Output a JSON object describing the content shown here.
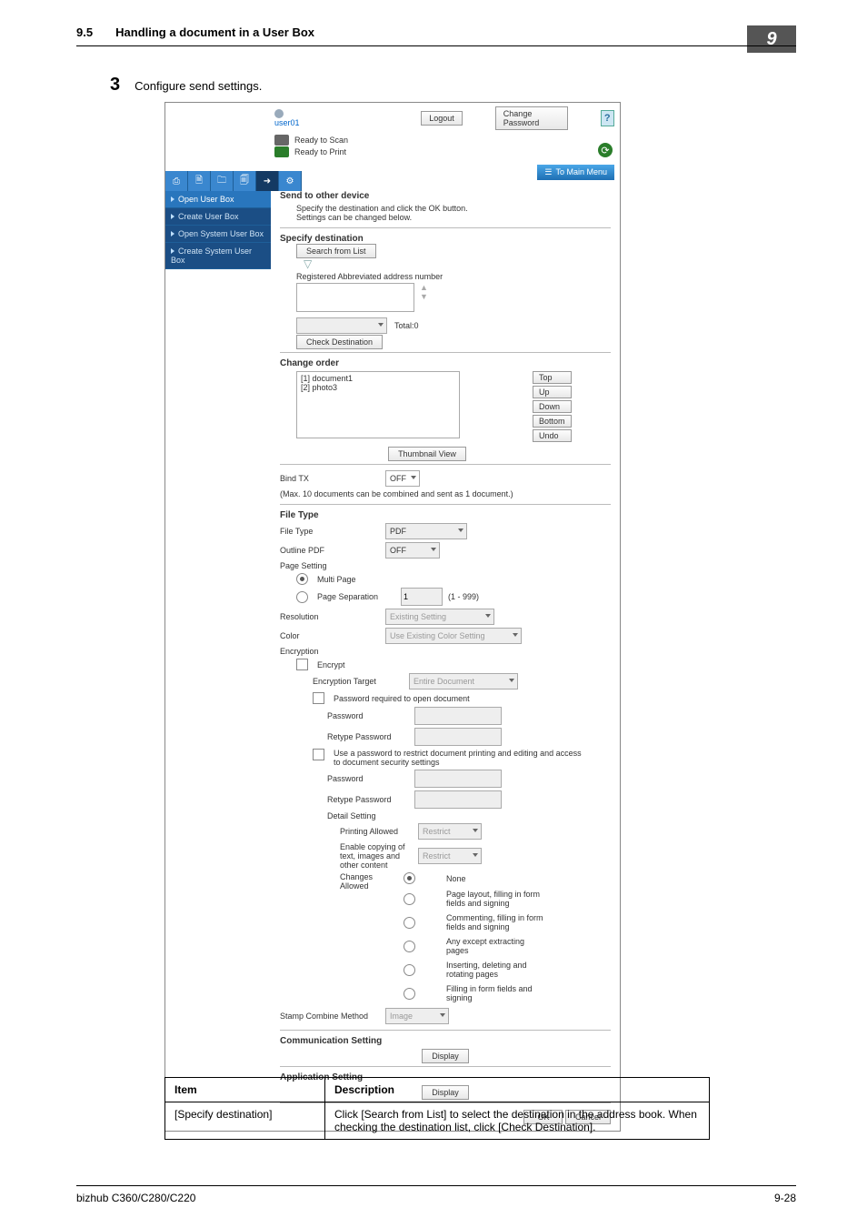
{
  "page": {
    "section_number": "9.5",
    "section_title": "Handling a document in a User Box",
    "chapter_number": "9",
    "step_number": "3",
    "step_text": "Configure send settings.",
    "model": "bizhub C360/C280/C220",
    "page_number": "9-28"
  },
  "screenshot": {
    "user": "user01",
    "buttons": {
      "logout": "Logout",
      "change_password": "Change Password"
    },
    "status": {
      "scan": "Ready to Scan",
      "print": "Ready to Print"
    },
    "main_menu": "To Main Menu",
    "sidebar": {
      "items": [
        {
          "label": "Open User Box",
          "active": true
        },
        {
          "label": "Create User Box",
          "active": false
        },
        {
          "label": "Open System User Box",
          "active": false
        },
        {
          "label": "Create System User Box",
          "active": false
        }
      ]
    },
    "send": {
      "heading": "Send to other device",
      "note1": "Specify the destination and click the OK button.",
      "note2": "Settings can be changed below."
    },
    "specify": {
      "heading": "Specify destination",
      "search_btn": "Search from List",
      "reg_label": "Registered Abbreviated address number",
      "total_label": "Total:0",
      "check_btn": "Check Destination"
    },
    "order": {
      "heading": "Change order",
      "items": [
        "[1] document1",
        "[2] photo3"
      ],
      "btns": {
        "top": "Top",
        "up": "Up",
        "down": "Down",
        "bottom": "Bottom",
        "undo": "Undo"
      },
      "thumb_btn": "Thumbnail View"
    },
    "bind": {
      "label": "Bind TX",
      "value": "OFF",
      "note": "(Max. 10 documents can be combined and sent as 1 document.)"
    },
    "filetype": {
      "heading": "File Type",
      "ft_label": "File Type",
      "ft_value": "PDF",
      "outline_label": "Outline PDF",
      "outline_value": "OFF",
      "page_setting": "Page Setting",
      "multipage": "Multi Page",
      "pagesep": "Page Separation",
      "pagesep_range": "(1 - 999)",
      "pagesep_value": "1",
      "res_label": "Resolution",
      "res_value": "Existing Setting",
      "color_label": "Color",
      "color_value": "Use Existing Color Setting",
      "enc_label": "Encryption",
      "enc_cb": "Encrypt",
      "enc_target_label": "Encryption Target",
      "enc_target_value": "Entire Document",
      "pw_open": "Password required to open document",
      "pw": "Password",
      "repw": "Retype Password",
      "use_pw_restrict": "Use a password to restrict document printing and editing and access to document security settings",
      "detail": "Detail Setting",
      "printing": "Printing Allowed",
      "printing_value": "Restrict",
      "copying": "Enable copying of text, images and other content",
      "copying_value": "Restrict",
      "changes": "Changes Allowed",
      "changes_opts": [
        "None",
        "Page layout, filling in form fields and signing",
        "Commenting, filling in form fields and signing",
        "Any except extracting pages",
        "Inserting, deleting and rotating pages",
        "Filling in form fields and signing"
      ],
      "stamp_label": "Stamp Combine Method",
      "stamp_value": "Image"
    },
    "comm": {
      "heading": "Communication Setting",
      "btn": "Display"
    },
    "app": {
      "heading": "Application Setting",
      "btn": "Display"
    },
    "footer_btns": {
      "ok": "OK",
      "cancel": "Cancel"
    }
  },
  "table": {
    "header": {
      "item": "Item",
      "desc": "Description"
    },
    "row": {
      "item": "[Specify destination]",
      "desc": "Click [Search from List] to select the destination in the address book. When checking the destination list, click [Check Destination]."
    }
  }
}
